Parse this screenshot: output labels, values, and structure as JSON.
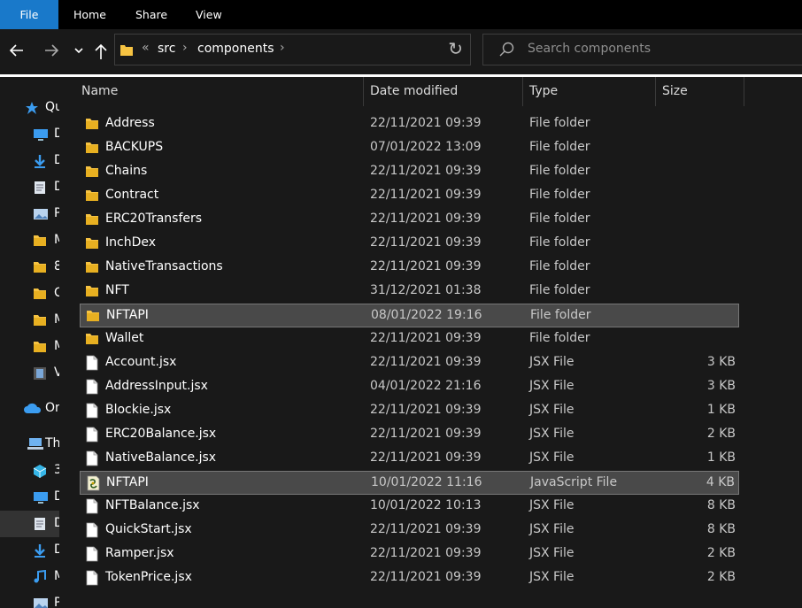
{
  "ribbon": {
    "file": "File",
    "home": "Home",
    "share": "Share",
    "view": "View"
  },
  "address": {
    "overflow": "«",
    "crumbs": [
      "src",
      "components"
    ]
  },
  "search": {
    "placeholder": "Search components"
  },
  "columns": {
    "name": "Name",
    "date": "Date modified",
    "type": "Type",
    "size": "Size"
  },
  "nav": [
    {
      "label": "Qu",
      "icon": "star-icon"
    },
    {
      "label": "D",
      "icon": "desktop-icon"
    },
    {
      "label": "D",
      "icon": "download-icon"
    },
    {
      "label": "D",
      "icon": "document-icon"
    },
    {
      "label": "P",
      "icon": "pictures-icon"
    },
    {
      "label": "M",
      "icon": "folder-icon"
    },
    {
      "label": "8",
      "icon": "folder-icon"
    },
    {
      "label": "C",
      "icon": "folder-icon"
    },
    {
      "label": "M",
      "icon": "folder-icon"
    },
    {
      "label": "M",
      "icon": "folder-icon"
    },
    {
      "label": "V",
      "icon": "video-icon"
    },
    {
      "label": "On",
      "icon": "onedrive-icon"
    },
    {
      "label": "Th",
      "icon": "this-pc-icon"
    },
    {
      "label": "3",
      "icon": "3d-objects-icon"
    },
    {
      "label": "D",
      "icon": "desktop-icon"
    },
    {
      "label": "D",
      "icon": "document-icon"
    },
    {
      "label": "D",
      "icon": "download-icon"
    },
    {
      "label": "M",
      "icon": "music-icon"
    },
    {
      "label": "P",
      "icon": "pictures-icon"
    }
  ],
  "files": [
    {
      "name": "Address",
      "date": "22/11/2021 09:39",
      "type": "File folder",
      "size": "",
      "kind": "folder"
    },
    {
      "name": "BACKUPS",
      "date": "07/01/2022 13:09",
      "type": "File folder",
      "size": "",
      "kind": "folder"
    },
    {
      "name": "Chains",
      "date": "22/11/2021 09:39",
      "type": "File folder",
      "size": "",
      "kind": "folder"
    },
    {
      "name": "Contract",
      "date": "22/11/2021 09:39",
      "type": "File folder",
      "size": "",
      "kind": "folder"
    },
    {
      "name": "ERC20Transfers",
      "date": "22/11/2021 09:39",
      "type": "File folder",
      "size": "",
      "kind": "folder"
    },
    {
      "name": "InchDex",
      "date": "22/11/2021 09:39",
      "type": "File folder",
      "size": "",
      "kind": "folder"
    },
    {
      "name": "NativeTransactions",
      "date": "22/11/2021 09:39",
      "type": "File folder",
      "size": "",
      "kind": "folder"
    },
    {
      "name": "NFT",
      "date": "31/12/2021 01:38",
      "type": "File folder",
      "size": "",
      "kind": "folder"
    },
    {
      "name": "NFTAPI",
      "date": "08/01/2022 19:16",
      "type": "File folder",
      "size": "",
      "kind": "folder",
      "selected": true
    },
    {
      "name": "Wallet",
      "date": "22/11/2021 09:39",
      "type": "File folder",
      "size": "",
      "kind": "folder"
    },
    {
      "name": "Account.jsx",
      "date": "22/11/2021 09:39",
      "type": "JSX File",
      "size": "3 KB",
      "kind": "file"
    },
    {
      "name": "AddressInput.jsx",
      "date": "04/01/2022 21:16",
      "type": "JSX File",
      "size": "3 KB",
      "kind": "file"
    },
    {
      "name": "Blockie.jsx",
      "date": "22/11/2021 09:39",
      "type": "JSX File",
      "size": "1 KB",
      "kind": "file"
    },
    {
      "name": "ERC20Balance.jsx",
      "date": "22/11/2021 09:39",
      "type": "JSX File",
      "size": "2 KB",
      "kind": "file"
    },
    {
      "name": "NativeBalance.jsx",
      "date": "22/11/2021 09:39",
      "type": "JSX File",
      "size": "1 KB",
      "kind": "file"
    },
    {
      "name": "NFTAPI",
      "date": "10/01/2022 11:16",
      "type": "JavaScript File",
      "size": "4 KB",
      "kind": "js",
      "selected": true
    },
    {
      "name": "NFTBalance.jsx",
      "date": "10/01/2022 10:13",
      "type": "JSX File",
      "size": "8 KB",
      "kind": "file"
    },
    {
      "name": "QuickStart.jsx",
      "date": "22/11/2021 09:39",
      "type": "JSX File",
      "size": "8 KB",
      "kind": "file"
    },
    {
      "name": "Ramper.jsx",
      "date": "22/11/2021 09:39",
      "type": "JSX File",
      "size": "2 KB",
      "kind": "file"
    },
    {
      "name": "TokenPrice.jsx",
      "date": "22/11/2021 09:39",
      "type": "JSX File",
      "size": "2 KB",
      "kind": "file"
    }
  ],
  "colors": {
    "accent": "#1979ca",
    "folder": "#f6c342",
    "background": "#191919"
  }
}
